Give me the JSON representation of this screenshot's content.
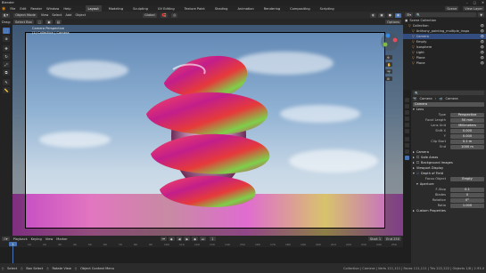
{
  "app": {
    "title": "Blender"
  },
  "topbar": {
    "menus": [
      "File",
      "Edit",
      "Render",
      "Window",
      "Help"
    ],
    "workspaces": [
      "Layout",
      "Modeling",
      "Sculpting",
      "UV Editing",
      "Texture Paint",
      "Shading",
      "Animation",
      "Rendering",
      "Compositing",
      "Scripting"
    ],
    "active_workspace": "Layout",
    "scene": "Scene",
    "view_layer": "View Layer"
  },
  "viewport_header": {
    "editor_mode": "Object Mode",
    "menus": [
      "View",
      "Select",
      "Add",
      "Object"
    ],
    "orientation": "Global",
    "transform_pivot": "Global",
    "drag": "Drag:",
    "select_box": "Select Box",
    "options": "Options"
  },
  "viewport": {
    "overlay_title": "Camera Perspective",
    "overlay_sub": "(1) Collection | Camera",
    "accent": "#4772b3"
  },
  "outliner": {
    "header": "Scene Collection",
    "items": [
      {
        "label": "Collection",
        "indent": 1
      },
      {
        "label": "Anthony_painting_multiple_inspo",
        "indent": 2
      },
      {
        "label": "Camera",
        "indent": 2,
        "selected": true
      },
      {
        "label": "Empty",
        "indent": 2
      },
      {
        "label": "Icosphere",
        "indent": 2
      },
      {
        "label": "Light",
        "indent": 2
      },
      {
        "label": "Plane",
        "indent": 2
      },
      {
        "label": "Plane",
        "indent": 2
      }
    ]
  },
  "properties": {
    "breadcrumb": [
      "Camera",
      "Camera"
    ],
    "datablock": "Camera",
    "lens_section": "Lens",
    "type_label": "Type",
    "type_value": "Perspective",
    "focal_label": "Focal Length",
    "focal_value": "50 mm",
    "lens_unit_label": "Lens Unit",
    "lens_unit_value": "Millimeters",
    "shift_label": "Shift X",
    "shift_x": "0.000",
    "shift_y_label": "Y",
    "shift_y": "0.000",
    "clip_label": "Clip Start",
    "clip_start": "0.1 m",
    "clip_end_label": "End",
    "clip_end": "1000 m",
    "camera_section": "Camera",
    "safe_areas": "Safe Areas",
    "background_images": "Background Images",
    "viewport_display": "Viewport Display",
    "dof_section": "Depth of Field",
    "focus_object_label": "Focus Object",
    "focus_object_value": "Empty",
    "aperture_section": "Aperture",
    "fstop_label": "F-Stop",
    "fstop": "0.1",
    "blades_label": "Blades",
    "blades": "0",
    "rotation_label": "Rotation",
    "rotation": "0°",
    "ratio_label": "Ratio",
    "ratio": "1.000",
    "custom_props": "Custom Properties"
  },
  "timeline": {
    "menus": [
      "Playback",
      "Keying",
      "View",
      "Marker"
    ],
    "current_frame": "1",
    "start_label": "Start",
    "start": "1",
    "end_label": "End",
    "end": "250",
    "ticks": [
      "0",
      "10",
      "20",
      "30",
      "40",
      "50",
      "60",
      "70",
      "80",
      "90",
      "100",
      "110",
      "120",
      "130",
      "140",
      "150",
      "160",
      "170",
      "180",
      "190",
      "200",
      "210",
      "220",
      "230",
      "240",
      "250"
    ]
  },
  "statusbar": {
    "select": "Select",
    "box_select": "Box Select",
    "rotate_view": "Rotate View",
    "context_menu": "Object Context Menu",
    "stats": "Collection | Camera | Verts 111,111 | Faces 111,111 | Tris 222,222 | Objects 1/8 | 2.93.0"
  }
}
